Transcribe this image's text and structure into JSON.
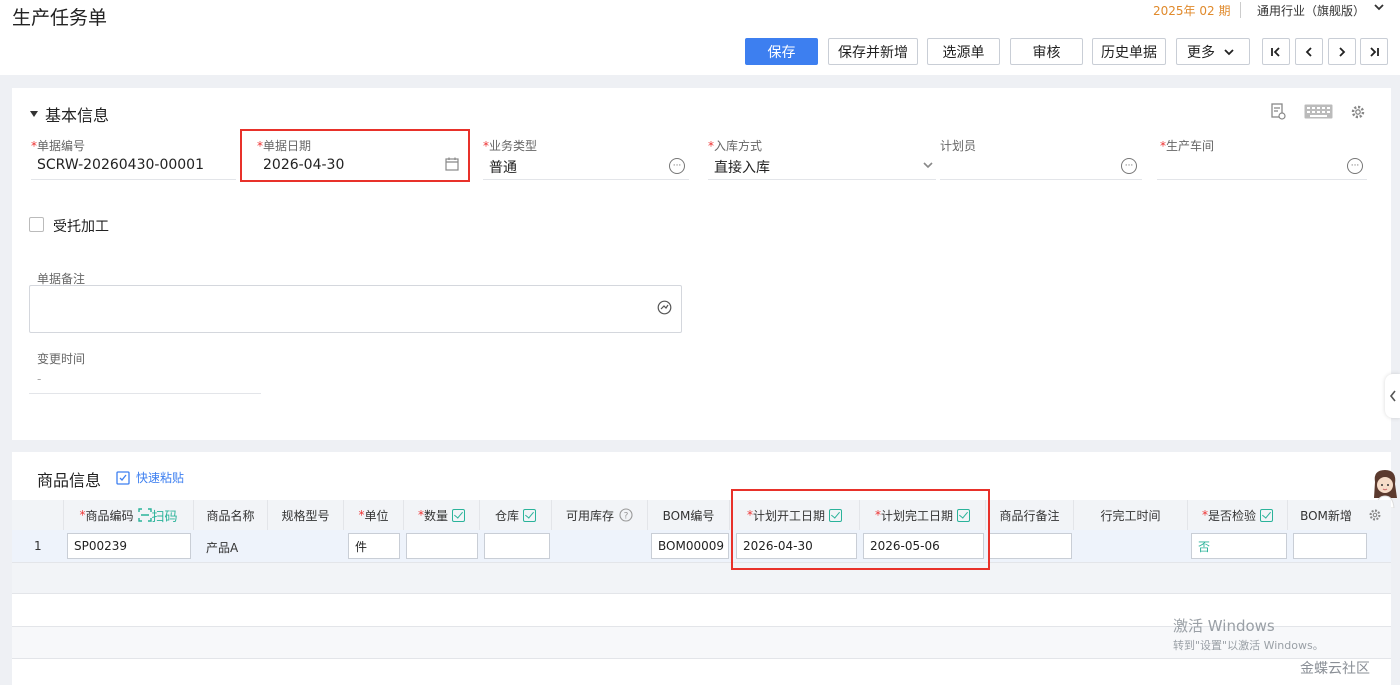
{
  "header": {
    "title": "生产任务单",
    "period": "2025年 02 期",
    "industry": "通用行业（旗舰版）"
  },
  "toolbar": {
    "save": "保存",
    "save_new": "保存并新增",
    "select_source": "选源单",
    "audit": "审核",
    "history": "历史单据",
    "more": "更多"
  },
  "basic": {
    "title": "基本信息",
    "doc_no_label": "单据编号",
    "doc_no": "SCRW-20260430-00001",
    "doc_date_label": "单据日期",
    "doc_date": "2026-04-30",
    "biz_type_label": "业务类型",
    "biz_type": "普通",
    "inbound_label": "入库方式",
    "inbound": "直接入库",
    "planner_label": "计划员",
    "workshop_label": "生产车间",
    "consign_label": "受托加工",
    "remark_label": "单据备注",
    "change_time_label": "变更时间",
    "change_time": "-"
  },
  "goods": {
    "title": "商品信息",
    "quick_paste": "快速粘贴",
    "scan": "扫码",
    "columns": {
      "code": "商品编码",
      "name": "商品名称",
      "spec": "规格型号",
      "unit": "单位",
      "qty": "数量",
      "warehouse": "仓库",
      "stock": "可用库存",
      "bom": "BOM编号",
      "plan_start": "计划开工日期",
      "plan_end": "计划完工日期",
      "row_remark": "商品行备注",
      "row_done": "行完工时间",
      "inspect": "是否检验",
      "bom_new": "BOM新增"
    },
    "rows": [
      {
        "index": "1",
        "code": "SP00239",
        "name": "产品A",
        "unit": "件",
        "bom": "BOM00009",
        "plan_start": "2026-04-30",
        "plan_end": "2026-05-06",
        "inspect": "否"
      }
    ]
  },
  "watermark": {
    "line1": "激活 Windows",
    "line2": "转到\"设置\"以激活 Windows。",
    "brand": "金蝶云社区"
  }
}
